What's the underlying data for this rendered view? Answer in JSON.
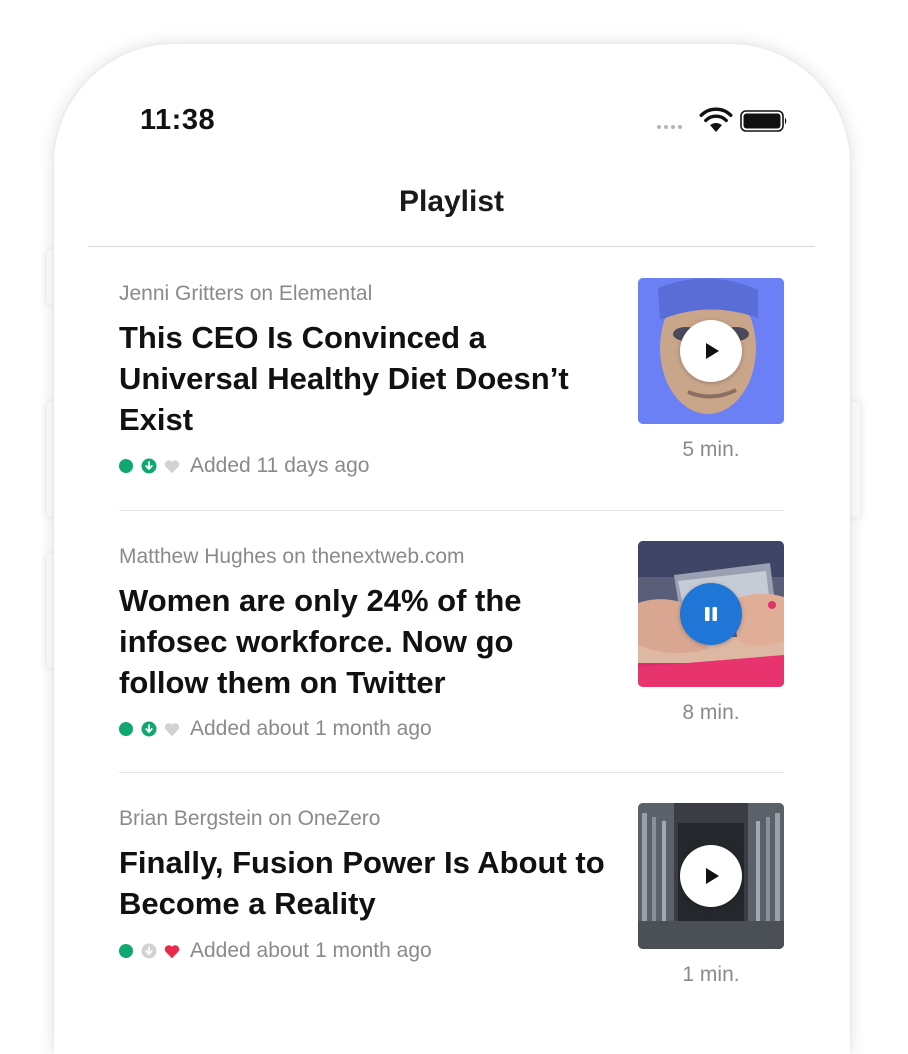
{
  "status_bar": {
    "time": "11:38",
    "signal_icon": "signal-dots-icon",
    "wifi_icon": "wifi-icon",
    "battery_icon": "battery-icon"
  },
  "nav": {
    "title": "Playlist"
  },
  "playlist": [
    {
      "byline": "Jenni Gritters on Elemental",
      "title": "This CEO Is Convinced a Universal Healthy Diet Doesn’t Exist",
      "added": "Added 11 days ago",
      "duration": "5 min.",
      "downloaded": true,
      "liked": false,
      "playing": false,
      "thumbnail": "portrait-photo-blue-tint"
    },
    {
      "byline": "Matthew Hughes on thenextweb.com",
      "title": "Women are only 24% of the infosec workforce. Now go follow them on Twitter",
      "added": "Added about 1 month ago",
      "duration": "8 min.",
      "downloaded": true,
      "liked": false,
      "playing": true,
      "thumbnail": "hands-holding-phone-photo"
    },
    {
      "byline": "Brian Bergstein on OneZero",
      "title": "Finally, Fusion Power Is About to Become a Reality",
      "added": "Added about 1 month ago",
      "duration": "1 min.",
      "downloaded": false,
      "liked": true,
      "playing": false,
      "thumbnail": "fusion-reactor-interior-photo"
    }
  ],
  "colors": {
    "accent_green": "#0fa86e",
    "heart_red": "#e8294a",
    "play_blue": "#1f76d6",
    "muted_text": "#8a8a8a"
  }
}
